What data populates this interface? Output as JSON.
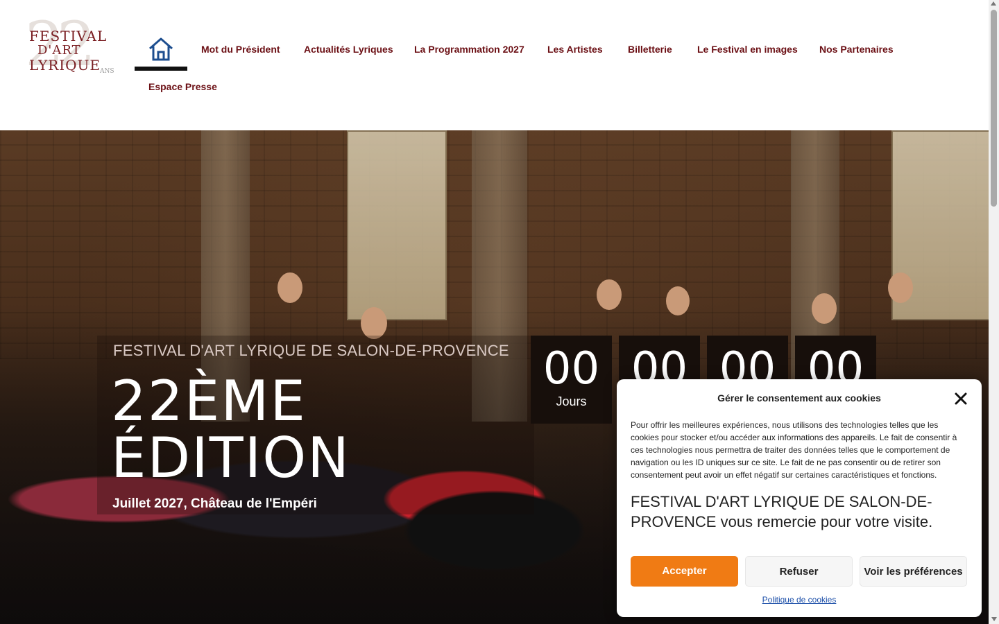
{
  "logo": {
    "line1": "FESTIVAL",
    "line2": "D'ART",
    "line3": "LYRIQUE",
    "years": "22",
    "ans": "ANS"
  },
  "nav": {
    "home_icon": "home-icon",
    "items": [
      "Mot du Président",
      "Actualités Lyriques",
      "La Programmation 2027",
      "Les Artistes",
      "Billetterie",
      "Le Festival en images",
      "Nos Partenaires",
      "Espace Presse"
    ]
  },
  "hero": {
    "subtitle": "FESTIVAL D'ART LYRIQUE DE SALON-DE-PROVENCE",
    "title_line1": "22ÈME",
    "title_line2": "ÉDITION",
    "date": "Juillet 2027, Château de l'Empéri"
  },
  "countdown": {
    "days": "00",
    "days_label": "Jours",
    "hours": "00",
    "minutes": "00",
    "seconds": "00"
  },
  "cookie": {
    "title": "Gérer le consentement aux cookies",
    "body": "Pour offrir les meilleures expériences, nous utilisons des technologies telles que les cookies pour stocker et/ou accéder aux informations des appareils. Le fait de consentir à ces technologies nous permettra de traiter des données telles que le comportement de navigation ou les ID uniques sur ce site. Le fait de ne pas consentir ou de retirer son consentement peut avoir un effet négatif sur certaines caractéristiques et fonctions.",
    "thanks": "FESTIVAL D'ART LYRIQUE DE SALON-DE-PROVENCE vous remercie pour votre visite.",
    "accept": "Accepter",
    "refuse": "Refuser",
    "preferences": "Voir les préférences",
    "policy_link": "Politique de cookies"
  },
  "colors": {
    "nav_text": "#6b0f14",
    "accept_button": "#f07b14",
    "countdown_bg": "#170f0b",
    "home_icon": "#1d4e8f"
  }
}
